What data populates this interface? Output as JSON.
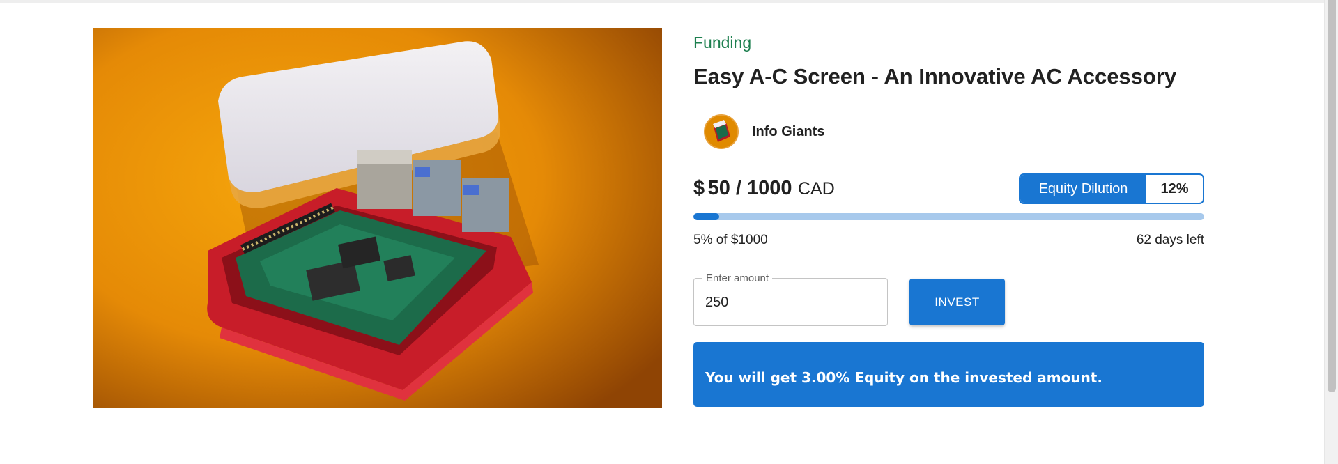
{
  "product": {
    "category": "Funding",
    "title": "Easy A-C Screen - An Innovative AC Accessory",
    "image": "raspberry-pi-in-case-photo"
  },
  "creator": {
    "name": "Info Giants",
    "avatar": "circuit-board-avatar"
  },
  "funding": {
    "currency_symbol": "$",
    "raised_and_goal": "50 / 1000",
    "currency_code": "CAD",
    "progress_percent": 5,
    "progress_text": "5% of $1000",
    "days_left": "62 days left"
  },
  "equity": {
    "label": "Equity Dilution",
    "value": "12%"
  },
  "invest_form": {
    "amount_label": "Enter amount",
    "amount_value": "250",
    "button_label": "INVEST"
  },
  "banner": {
    "message": "You will get 3.00% Equity on the invested amount."
  },
  "colors": {
    "primary": "#1976d2",
    "category_green": "#1d7f4f",
    "progress_track": "#a7c9ec"
  }
}
